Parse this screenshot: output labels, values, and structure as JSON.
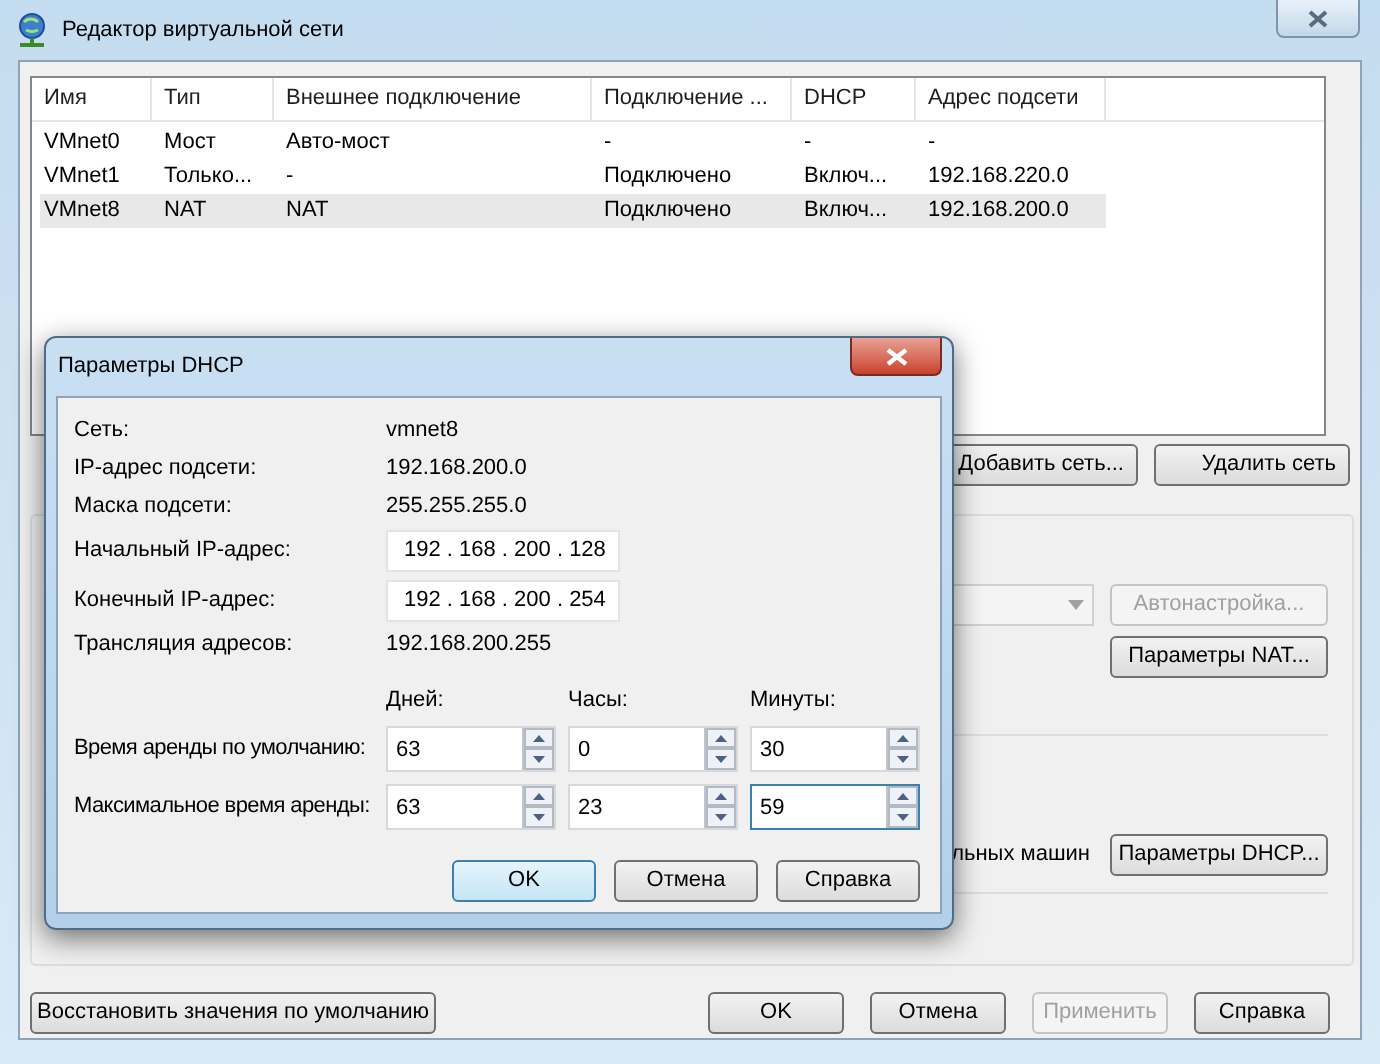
{
  "window": {
    "title": "Редактор виртуальной сети"
  },
  "table": {
    "columns": [
      "Имя",
      "Тип",
      "Внешнее подключение",
      "Подключение ...",
      "DHCP",
      "Адрес подсети"
    ],
    "rows": [
      {
        "cells": [
          "VMnet0",
          "Мост",
          "Авто-мост",
          "-",
          "-",
          "-"
        ],
        "selected": false
      },
      {
        "cells": [
          "VMnet1",
          "Только...",
          "-",
          "Подключено",
          "Включ...",
          "192.168.220.0"
        ],
        "selected": false
      },
      {
        "cells": [
          "VMnet8",
          "NAT",
          "NAT",
          "Подключено",
          "Включ...",
          "192.168.200.0"
        ],
        "selected": true
      }
    ]
  },
  "network_buttons": [
    {
      "label": "Добавить сеть..."
    },
    {
      "label": "Удалить сеть"
    }
  ],
  "settings": {
    "combo": {
      "disabled": true
    },
    "autoconfig_button": {
      "label": "Автонастройка...",
      "disabled": true
    },
    "nat_button": {
      "label": "Параметры NAT...",
      "disabled": false
    },
    "dhcp_label": "льных машин",
    "dhcp_button": {
      "label": "Параметры DHCP...",
      "disabled": false
    }
  },
  "bottom_buttons": [
    {
      "label": "Восстановить значения по умолчанию",
      "disabled": false
    },
    {
      "label": "OK",
      "disabled": false
    },
    {
      "label": "Отмена",
      "disabled": false
    },
    {
      "label": "Применить",
      "disabled": true
    },
    {
      "label": "Справка",
      "disabled": false
    }
  ],
  "dhcp_dialog": {
    "title": "Параметры DHCP",
    "info": [
      {
        "kind": "text",
        "label": "Сеть:",
        "value": "vmnet8"
      },
      {
        "kind": "text",
        "label": "IP-адрес подсети:",
        "value": "192.168.200.0"
      },
      {
        "kind": "text",
        "label": "Маска подсети:",
        "value": "255.255.255.0"
      },
      {
        "kind": "field",
        "label": "Начальный IP-адрес:",
        "value": "192 . 168 . 200 . 128"
      },
      {
        "kind": "field",
        "label": "Конечный IP-адрес:",
        "value": "192 . 168 . 200 . 254"
      },
      {
        "kind": "text",
        "label": "Трансляция адресов:",
        "value": "192.168.200.255"
      }
    ],
    "lease": {
      "columns": [
        "Дней:",
        "Часы:",
        "Минуты:"
      ],
      "rows": [
        {
          "label": "Время аренды по умолчанию:",
          "values": [
            {
              "value": "63",
              "focused": false
            },
            {
              "value": "0",
              "focused": false
            },
            {
              "value": "30",
              "focused": false
            }
          ]
        },
        {
          "label": "Максимальное время аренды:",
          "values": [
            {
              "value": "63",
              "focused": false
            },
            {
              "value": "23",
              "focused": false
            },
            {
              "value": "59",
              "focused": true
            }
          ]
        }
      ]
    },
    "buttons": [
      {
        "label": "OK",
        "default": true
      },
      {
        "label": "Отмена",
        "default": false
      },
      {
        "label": "Справка",
        "default": false
      }
    ]
  }
}
